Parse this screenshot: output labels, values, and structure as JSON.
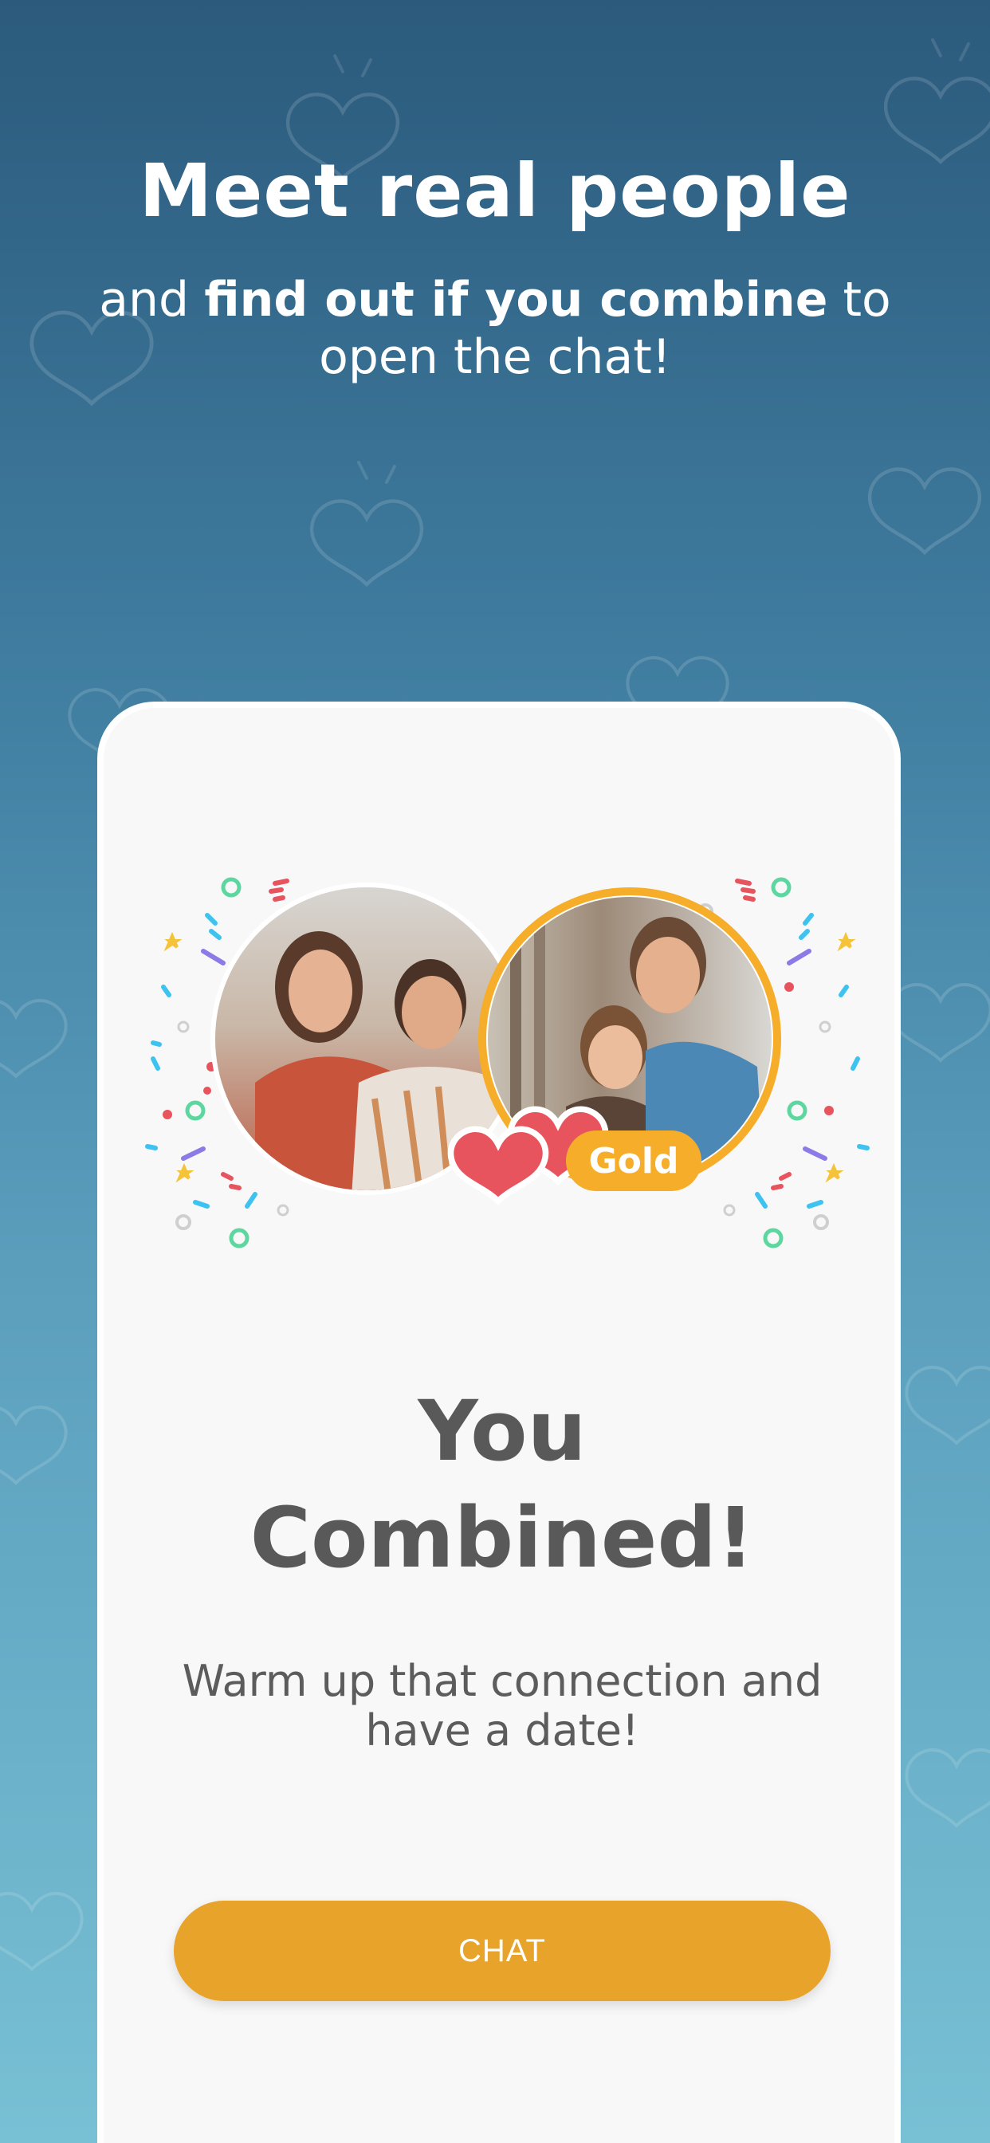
{
  "header": {
    "headline": "Meet real people",
    "sub_pre": "and ",
    "sub_bold": "find out if you combine",
    "sub_post": " to open the chat!"
  },
  "card": {
    "title_line1": "You",
    "title_line2": "Combined!",
    "desc_line1": "Warm up that connection and",
    "desc_line2": "have a date!",
    "badge_label": "Gold",
    "chat_button_label": "CHAT"
  },
  "colors": {
    "accent": "#e8a32b",
    "heart": "#e8545e",
    "gold_ring": "#f5ad2a"
  },
  "icons": [
    "heart-icon",
    "confetti-icon",
    "star-icon"
  ]
}
